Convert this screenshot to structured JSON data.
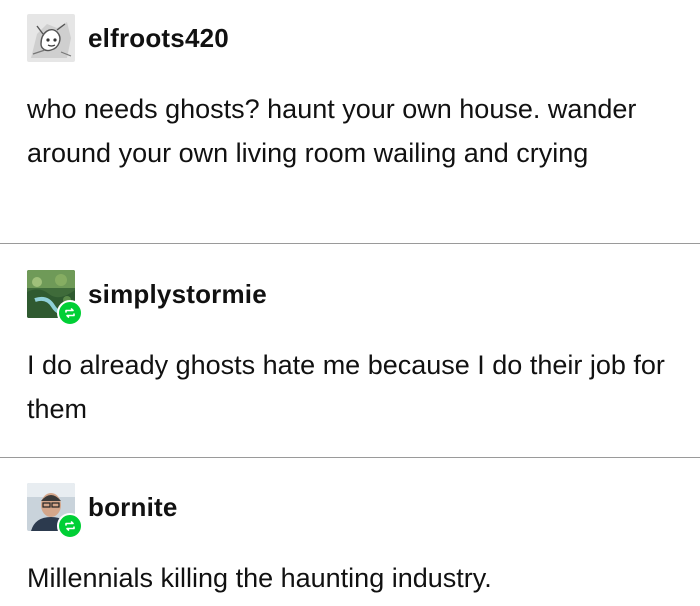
{
  "posts": [
    {
      "username": "elfroots420",
      "avatar": "avatar-elfroots420",
      "reblogged": false,
      "text": "who needs ghosts? haunt your own house. wander around your own living room wailing and crying"
    },
    {
      "username": "simplystormie",
      "avatar": "avatar-simplystormie",
      "reblogged": true,
      "text": "I do already ghosts hate me because I do their job for them"
    },
    {
      "username": "bornite",
      "avatar": "avatar-bornite",
      "reblogged": true,
      "text": "Millennials killing the haunting industry."
    }
  ],
  "colors": {
    "reblog_badge": "#00cf35",
    "divider": "#9a9a9a",
    "text": "#111111"
  },
  "icons": {
    "reblog": "reblog-icon"
  }
}
